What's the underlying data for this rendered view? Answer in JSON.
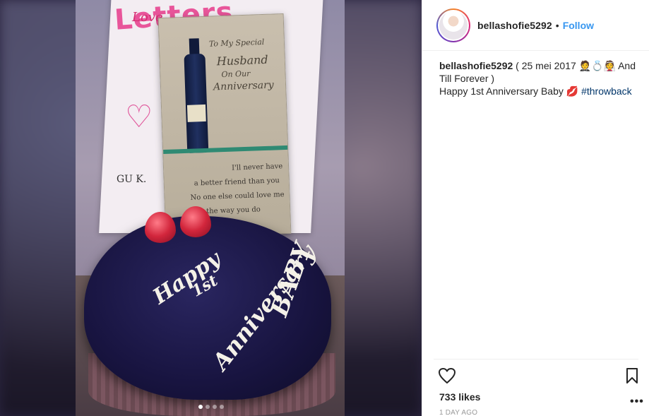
{
  "header": {
    "username": "bellashofie5292",
    "separator": "•",
    "follow_label": "Follow"
  },
  "caption": {
    "username": "bellashofie5292",
    "line1": " ( 25 mei 2017 🤵💍👰 And Till Forever )",
    "line2": "Happy 1st Anniversary Baby 💋 ",
    "hashtag": "#throwback"
  },
  "stats": {
    "likes_label": "733 likes",
    "time_label": "1 DAY AGO"
  },
  "icons": {
    "like": "heart-icon",
    "save": "bookmark-icon",
    "more": "more-options-icon"
  },
  "carousel": {
    "count": 4,
    "active_index": 0
  },
  "photo_text": {
    "bag_word": "Letters",
    "bag_word2": "Love",
    "card_line1": "To My Special",
    "card_line2": "Husband",
    "card_line3": "On Our",
    "card_line4": "Anniversary",
    "card_lower1": "I'll never have",
    "card_lower2": "a better friend than you",
    "card_lower3": "No one else could love me",
    "card_lower4": "the way you do",
    "cake_line1": "Happy",
    "cake_line2": "1st",
    "cake_line3": "Anniversary",
    "cake_line4": "BABY",
    "bag_letters": "GU K."
  },
  "colors": {
    "follow": "#3897f0",
    "hashtag": "#003569",
    "muted": "#999999",
    "text": "#262626"
  }
}
